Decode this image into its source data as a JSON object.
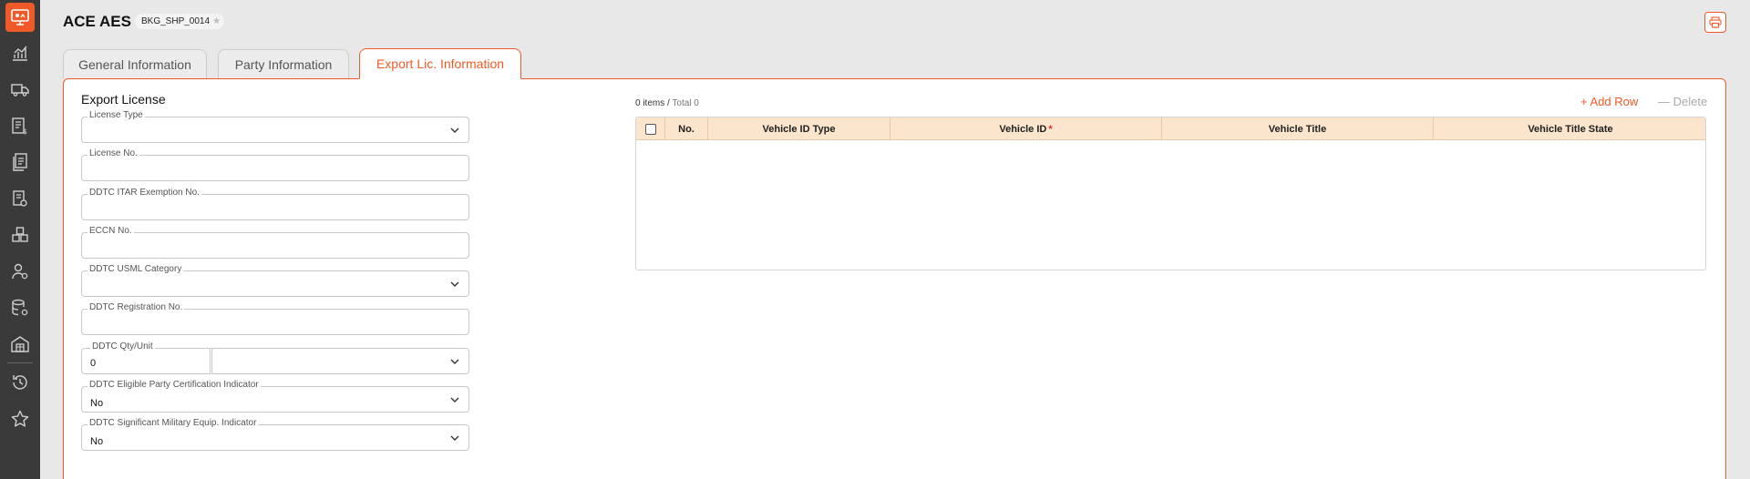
{
  "app": {
    "title": "ACE AES",
    "badge": "BKG_SHP_0014"
  },
  "sidebar": {
    "items": [
      {
        "icon": "analytics-icon"
      },
      {
        "icon": "truck-icon"
      },
      {
        "icon": "billing-icon"
      },
      {
        "icon": "documents-icon"
      },
      {
        "icon": "document-settings-icon"
      },
      {
        "icon": "packages-icon"
      },
      {
        "icon": "user-settings-icon"
      },
      {
        "icon": "database-settings-icon"
      },
      {
        "icon": "warehouse-icon"
      },
      {
        "icon": "history-icon"
      },
      {
        "icon": "star-icon"
      }
    ]
  },
  "tabs": [
    {
      "label": "General Information",
      "active": false
    },
    {
      "label": "Party Information",
      "active": false
    },
    {
      "label": "Export Lic. Information",
      "active": true
    }
  ],
  "form": {
    "section_title": "Export License",
    "fields": [
      {
        "label": "License Type",
        "value": "",
        "type": "select"
      },
      {
        "label": "License No.",
        "value": "",
        "type": "text"
      },
      {
        "label": "DDTC ITAR Exemption No.",
        "value": "",
        "type": "text"
      },
      {
        "label": "ECCN No.",
        "value": "",
        "type": "text"
      },
      {
        "label": "DDTC USML Category",
        "value": "",
        "type": "select"
      },
      {
        "label": "DDTC Registration No.",
        "value": "",
        "type": "text"
      }
    ],
    "qty_unit": {
      "label": "DDTC Qty/Unit",
      "qty": "0",
      "unit": ""
    },
    "eligible_party": {
      "label": "DDTC Eligible Party Certification Indicator",
      "value": "No"
    },
    "significant_military": {
      "label": "DDTC Significant Military Equip. Indicator",
      "value": "No"
    }
  },
  "grid": {
    "items": "0 items",
    "total": "Total 0",
    "add_row": "Add Row",
    "delete": "Delete",
    "columns": [
      "No.",
      "Vehicle ID Type",
      "Vehicle ID",
      "Vehicle Title",
      "Vehicle Title State"
    ],
    "required_marker": "*",
    "rows": []
  },
  "colors": {
    "accent": "#f05a28",
    "sidebar": "#3a3a3a",
    "grid_header": "#fbe5cc"
  }
}
